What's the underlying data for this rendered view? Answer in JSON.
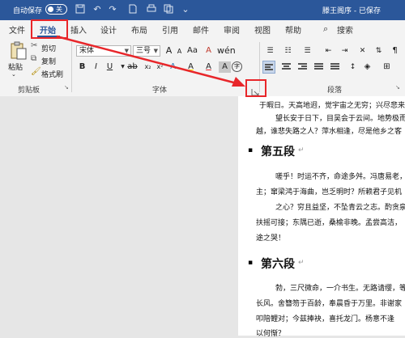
{
  "titlebar": {
    "autosave_label": "自动保存",
    "toggle_label": "关",
    "doc_title": "滕王阁序 - 已保存"
  },
  "tabs": [
    "文件",
    "开始",
    "插入",
    "设计",
    "布局",
    "引用",
    "邮件",
    "审阅",
    "视图",
    "帮助",
    "搜索"
  ],
  "clipboard": {
    "paste_label": "粘贴",
    "cut_label": "剪切",
    "copy_label": "复制",
    "format_painter_label": "格式刷",
    "group_label": "剪贴板"
  },
  "font": {
    "font_name": "宋体",
    "font_size": "三号",
    "bold": "B",
    "italic": "I",
    "underline": "U",
    "grow": "A",
    "shrink": "A",
    "clear_format": "A",
    "highlight": "A",
    "font_color": "A",
    "char_shading": "A",
    "enclose": "字",
    "group_label": "字体"
  },
  "paragraph": {
    "group_label": "段落"
  },
  "document": {
    "lines": [
      "于暇日。天高地迥，觉宇宙之无穷；兴尽悲来",
      "望长安于日下，目吴会于云间。地势极而",
      "越，谁悲失路之人？萍水相逢，尽是他乡之客",
      "第五段",
      "嗟乎！时运不齐，命途多舛。冯唐易老，",
      "主；窜梁鸿于海曲，岂乏明时？所赖君子见机",
      "之心？穷且益坚，不坠青云之志。酌贪泉",
      "扶摇可接；东隅已逝，桑榆非晚。孟尝高洁，",
      "途之哭！",
      "第六段",
      "勃，三尺微命，一介书生。无路请缨，等",
      "长风。舍簪笏于百龄，奉晨昏于万里。非谢家",
      "叩陪鲤对；今兹捧袂，喜托龙门。杨意不逢",
      "以何惭？"
    ]
  },
  "colors": {
    "title_bar": "#2b579a",
    "ribbon": "#f3f3f3",
    "annotation": "#e8262a"
  }
}
